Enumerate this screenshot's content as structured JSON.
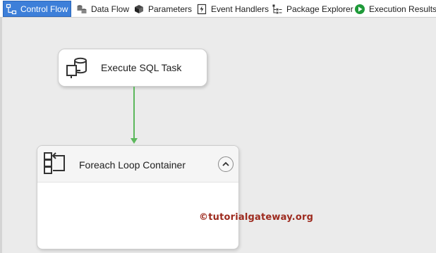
{
  "tabs": [
    {
      "label": "Control Flow",
      "icon": "control-flow-icon",
      "active": true
    },
    {
      "label": "Data Flow",
      "icon": "data-flow-icon",
      "active": false
    },
    {
      "label": "Parameters",
      "icon": "parameters-icon",
      "active": false
    },
    {
      "label": "Event Handlers",
      "icon": "event-handlers-icon",
      "active": false
    },
    {
      "label": "Package Explorer",
      "icon": "package-explorer-icon",
      "active": false
    },
    {
      "label": "Execution Results",
      "icon": "execution-results-icon",
      "active": false
    }
  ],
  "canvas": {
    "task": {
      "label": "Execute SQL Task",
      "icon": "execute-sql-task-icon"
    },
    "connector": {
      "color": "#5cb85c"
    },
    "container": {
      "label": "Foreach Loop Container",
      "icon": "foreach-loop-icon",
      "collapse_icon": "chevron-up-icon"
    }
  },
  "watermark": "©tutorialgateway.org",
  "colors": {
    "active_tab": "#3d7fd9",
    "canvas_bg": "#ebebeb",
    "watermark": "#9d2a1e",
    "success": "#1f9a3a"
  }
}
